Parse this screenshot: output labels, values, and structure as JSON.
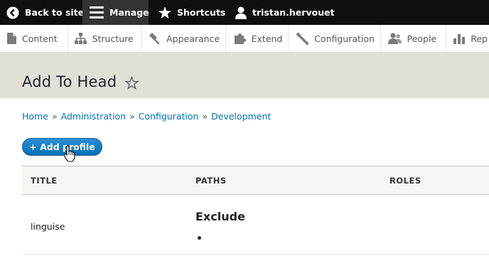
{
  "toolbar": {
    "back": "Back to site",
    "manage": "Manage",
    "shortcuts": "Shortcuts",
    "user": "tristan.hervouet"
  },
  "tray": {
    "items": [
      {
        "label": "Content",
        "icon": "file-icon"
      },
      {
        "label": "Structure",
        "icon": "sitemap-icon"
      },
      {
        "label": "Appearance",
        "icon": "paint-icon"
      },
      {
        "label": "Extend",
        "icon": "puzzle-icon"
      },
      {
        "label": "Configuration",
        "icon": "wrench-icon"
      },
      {
        "label": "People",
        "icon": "people-icon"
      },
      {
        "label": "Rep",
        "icon": "chart-icon"
      }
    ]
  },
  "page": {
    "title": "Add To Head"
  },
  "breadcrumb": {
    "items": [
      "Home",
      "Administration",
      "Configuration",
      "Development"
    ],
    "separator": "»"
  },
  "actions": {
    "add_profile": "+ Add profile"
  },
  "table": {
    "headers": [
      "TITLE",
      "PATHS",
      "ROLES"
    ],
    "rows": [
      {
        "title": "linguise",
        "paths_heading": "Exclude"
      }
    ]
  },
  "colors": {
    "toolbar_bg": "#0f0f0f",
    "header_bg": "#e0e0d8",
    "link": "#0074bd",
    "button": "#0071b8"
  }
}
